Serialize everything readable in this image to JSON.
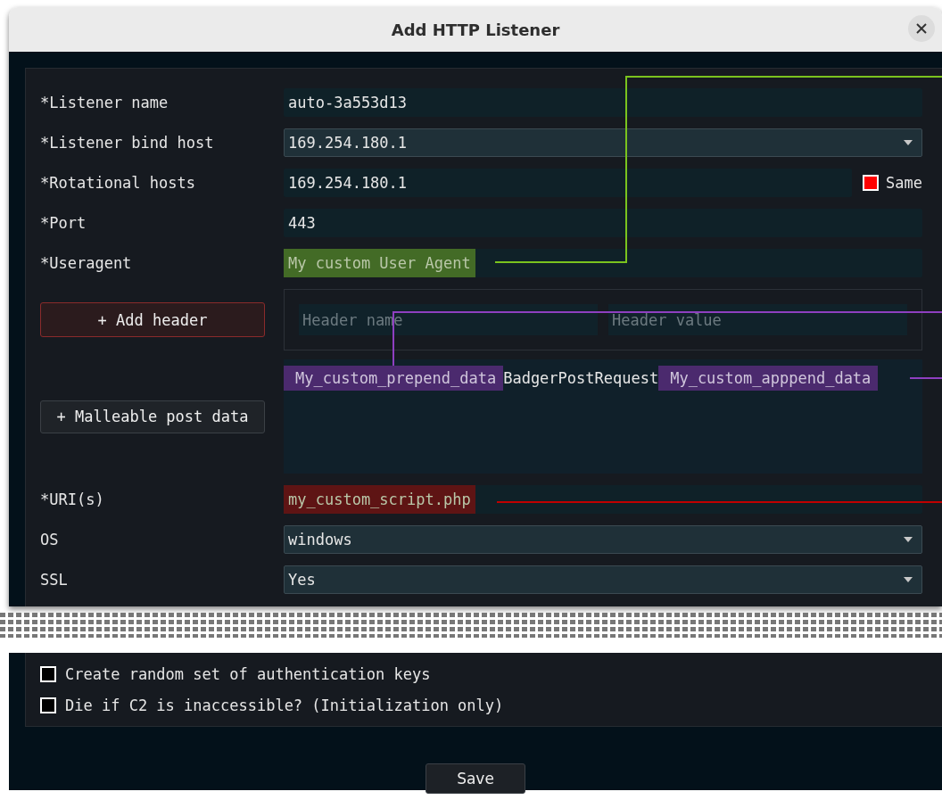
{
  "window": {
    "title": "Add HTTP Listener"
  },
  "fields": [
    {
      "label": "*Listener name",
      "kind": "text",
      "value": "auto-3a553d13"
    },
    {
      "label": "*Listener bind host",
      "kind": "select",
      "value": "169.254.180.1"
    },
    {
      "label": "*Rotational hosts",
      "kind": "text",
      "value": "169.254.180.1",
      "same": {
        "label": "Same",
        "checked": true
      }
    },
    {
      "label": "*Port",
      "kind": "text",
      "value": "443"
    },
    {
      "label": "*Useragent",
      "kind": "text",
      "value": "My custom User Agent",
      "color": "#436b26"
    }
  ],
  "headers": {
    "button": "+ Add header",
    "name_placeholder": "Header name",
    "value_placeholder": "Header value"
  },
  "post_data": {
    "button": "+ Malleable post data",
    "segments": [
      {
        "text": "My_custom_prepend_data",
        "color": "#4b2a6e"
      },
      {
        "text": "BadgerPostRequest"
      },
      {
        "text": "My_custom_apppend_data",
        "color": "#4b2a6e"
      }
    ]
  },
  "fields_more": [
    {
      "label": "*URI(s)",
      "kind": "text",
      "value": "my_custom_script.php",
      "color": "#5e1414"
    },
    {
      "label": "OS",
      "kind": "select",
      "value": "windows"
    },
    {
      "label": "SSL",
      "kind": "select",
      "value": "Yes"
    }
  ],
  "options": [
    {
      "label": "Create random set of authentication keys",
      "checked": false
    },
    {
      "label": "Die if C2 is inaccessible? (Initialization only)",
      "checked": false
    }
  ],
  "save_button": "Save"
}
